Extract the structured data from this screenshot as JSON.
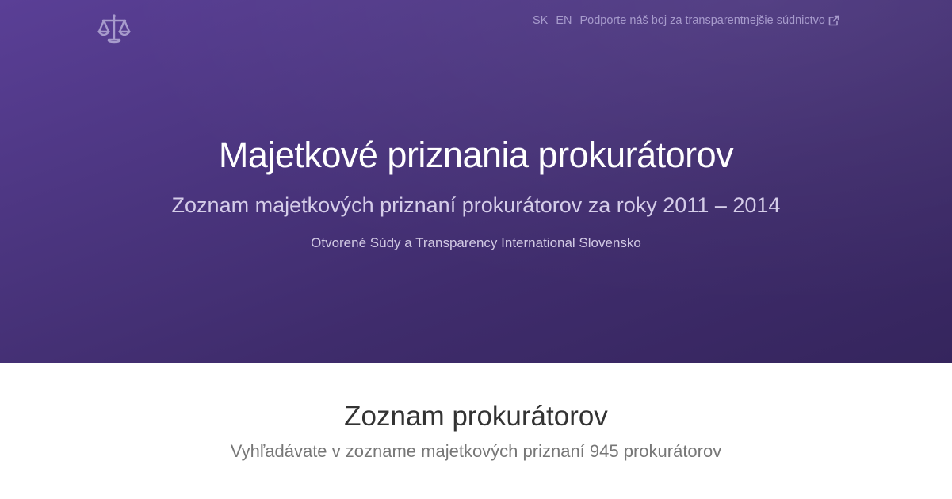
{
  "nav": {
    "logo_icon": "scales-of-justice-icon",
    "lang_sk": "SK",
    "lang_en": "EN",
    "support_link": "Podporte náš boj za transparentnejšie súdnictvo",
    "support_icon": "external-link-icon"
  },
  "hero": {
    "title": "Majetkové priznania prokurátorov",
    "subtitle": "Zoznam majetkových priznaní prokurátorov za roky 2011 – 2014",
    "authors": "Otvorené Súdy a Transparency International Slovensko"
  },
  "list_section": {
    "title": "Zoznam prokurátorov",
    "subtitle": "Vyhľadávate v zozname majetkových priznaní 945 prokurátorov"
  },
  "colors": {
    "hero_gradient_start": "#5a3f96",
    "hero_gradient_end": "#35255d",
    "nav_text": "#a79bcc",
    "title_text": "#ffffff"
  }
}
